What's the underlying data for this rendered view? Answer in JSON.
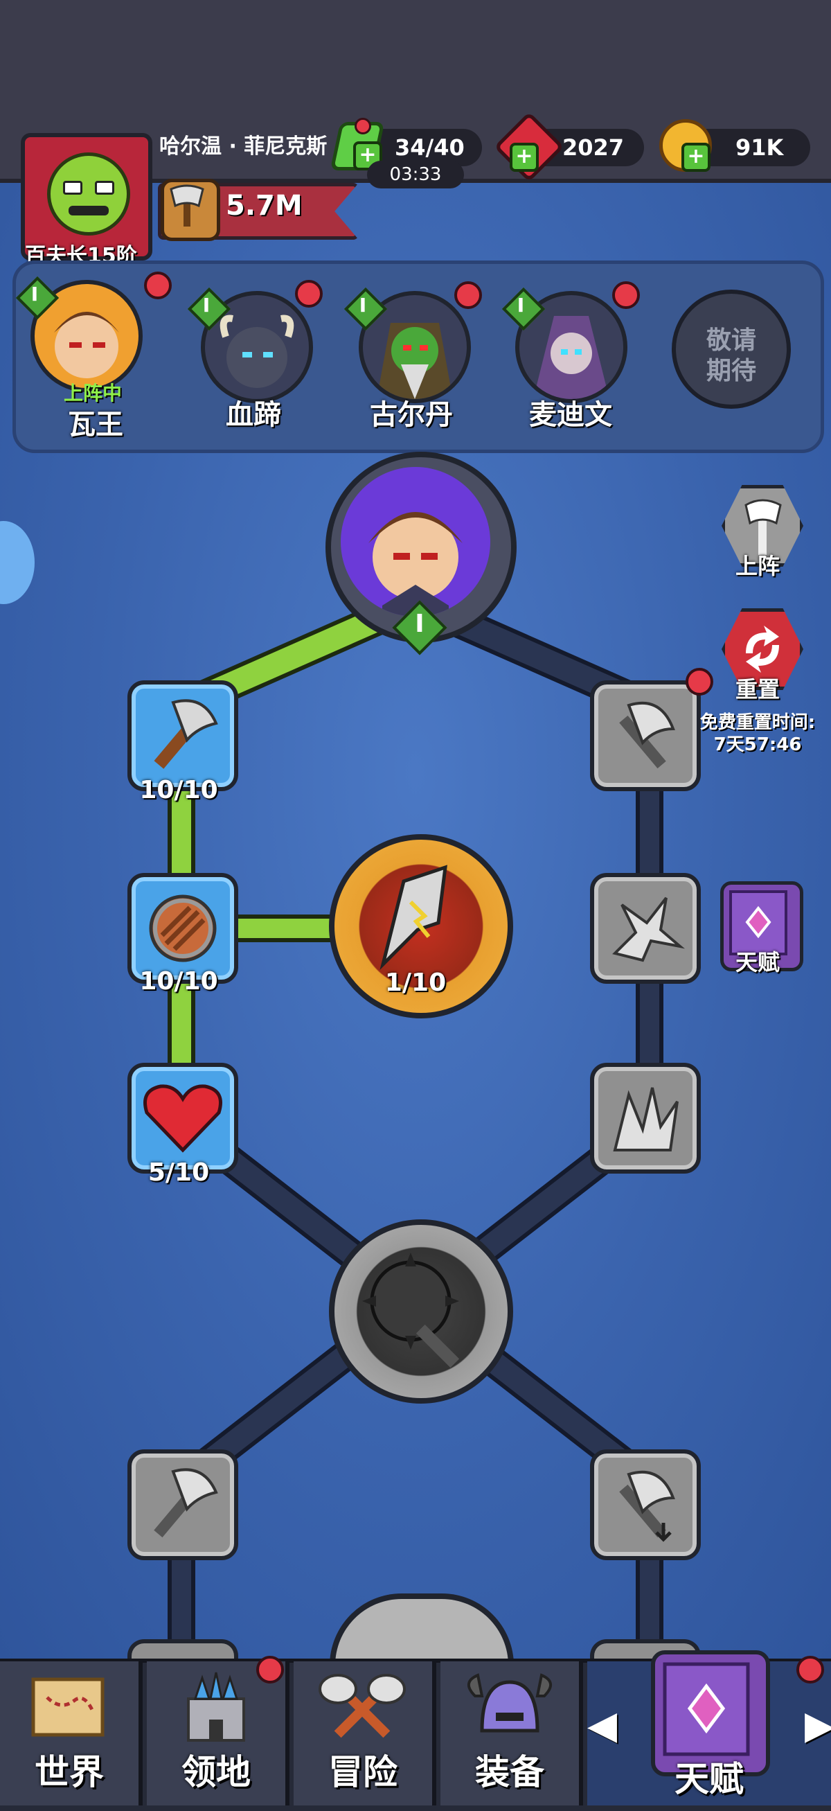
{
  "player": {
    "name": "哈尔温 · 菲尼克斯",
    "rank": "百夫长15阶",
    "power": "5.7M"
  },
  "resources": {
    "energy": "34/40",
    "energy_timer": "03:33",
    "gems": "2027",
    "gold": "91K"
  },
  "heroes": [
    {
      "name": "瓦王",
      "level": "I",
      "status": "上阵中"
    },
    {
      "name": "血蹄",
      "level": "I"
    },
    {
      "name": "古尔丹",
      "level": "I"
    },
    {
      "name": "麦迪文",
      "level": "I"
    }
  ],
  "coming_soon": "敬请\n期待",
  "talent": {
    "hero_level": "I",
    "nodes": [
      {
        "id": "axe",
        "label": "10/10"
      },
      {
        "id": "shield",
        "label": "10/10"
      },
      {
        "id": "heart",
        "label": "5/10"
      },
      {
        "id": "core",
        "label": "1/10"
      }
    ]
  },
  "side_buttons": {
    "deploy": "上阵",
    "reset": "重置",
    "reset_note_line1": "免费重置时间:",
    "reset_note_line2": "7天57:46",
    "talent": "天赋"
  },
  "nav": {
    "world": "世界",
    "territory": "领地",
    "adventure": "冒险",
    "equipment": "装备",
    "talent": "天赋"
  },
  "colors": {
    "accent_green": "#8fd23f",
    "node_blue": "#4aa3e8",
    "badge_red": "#e63a48"
  }
}
